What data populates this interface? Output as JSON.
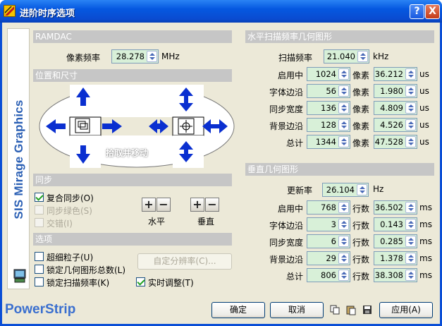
{
  "window": {
    "title": "进阶时序选项",
    "help": "?",
    "close": "X"
  },
  "brand": {
    "sidebar": "SIS Mirage Graphics",
    "logo": "PowerStrip"
  },
  "ramdac": {
    "header": "RAMDAC",
    "pixel_label": "像素频率",
    "pixel_value": "28.278",
    "pixel_unit": "MHz"
  },
  "position": {
    "header": "位置和尺寸",
    "drag_label": "拾取并移动"
  },
  "sync": {
    "header": "同步",
    "composite": "复合同步(O)",
    "sync_green": "同步绿色(S)",
    "interlace": "交错(I)",
    "h_label": "水平",
    "v_label": "垂直"
  },
  "options": {
    "header": "选项",
    "ultrafine": "超细粒子(U)",
    "lock_geo": "锁定几何图形总数(L)",
    "lock_scan": "锁定扫描频率(K)",
    "realtime": "实时调整(T)",
    "custom_res": "自定分辨率(C)..."
  },
  "horizontal": {
    "header": "水平扫描频率几何图形",
    "scan_label": "扫描频率",
    "scan_value": "21.040",
    "scan_unit": "kHz",
    "rows": [
      {
        "label": "启用中",
        "px": "1024",
        "px_unit": "像素",
        "us": "36.212",
        "us_unit": "us"
      },
      {
        "label": "字体边沿",
        "px": "56",
        "px_unit": "像素",
        "us": "1.980",
        "us_unit": "us"
      },
      {
        "label": "同步宽度",
        "px": "136",
        "px_unit": "像素",
        "us": "4.809",
        "us_unit": "us"
      },
      {
        "label": "背景边沿",
        "px": "128",
        "px_unit": "像素",
        "us": "4.526",
        "us_unit": "us"
      },
      {
        "label": "总计",
        "px": "1344",
        "px_unit": "像素",
        "us": "47.528",
        "us_unit": "us"
      }
    ]
  },
  "vertical": {
    "header": "垂直几何图形",
    "refresh_label": "更新率",
    "refresh_value": "26.104",
    "refresh_unit": "Hz",
    "rows": [
      {
        "label": "启用中",
        "ln": "768",
        "ln_unit": "行数",
        "ms": "36.502",
        "ms_unit": "ms"
      },
      {
        "label": "字体边沿",
        "ln": "3",
        "ln_unit": "行数",
        "ms": "0.143",
        "ms_unit": "ms"
      },
      {
        "label": "同步宽度",
        "ln": "6",
        "ln_unit": "行数",
        "ms": "0.285",
        "ms_unit": "ms"
      },
      {
        "label": "背景边沿",
        "ln": "29",
        "ln_unit": "行数",
        "ms": "1.378",
        "ms_unit": "ms"
      },
      {
        "label": "总计",
        "ln": "806",
        "ln_unit": "行数",
        "ms": "38.308",
        "ms_unit": "ms"
      }
    ]
  },
  "footer": {
    "ok": "确定",
    "cancel": "取消",
    "apply": "应用(A)"
  },
  "colors": {
    "titlebar": "#0a4ed6",
    "section": "#c6c6c6",
    "field": "#d8f0d8",
    "arrow": "#0a2fd0"
  }
}
